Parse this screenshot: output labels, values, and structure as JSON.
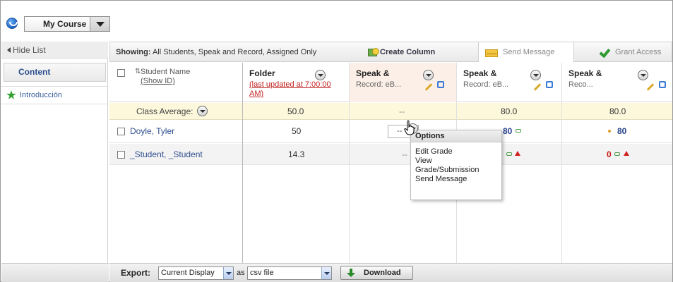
{
  "top": {
    "course_label": "My Course"
  },
  "left": {
    "hide_list": "Hide List",
    "content_tab": "Content",
    "items": [
      "Introducción"
    ]
  },
  "toolbar": {
    "showing_label": "Showing:",
    "showing_value": "All Students, Speak and Record, Assigned Only",
    "create_column": "Create Column",
    "send_message": "Send Message",
    "grant_access": "Grant Access"
  },
  "columns": {
    "student_name": "Student Name",
    "show_id": "(Show ID)",
    "folder_title": "Folder",
    "folder_sub": "(last updated at 7:00:00 AM)",
    "speak1_title": "Speak &",
    "speak1_sub": "Record: eB...",
    "speak2_title": "Speak &",
    "speak2_sub": "Record: eB...",
    "speak3_title": "Speak &",
    "speak3_sub": "Reco..."
  },
  "average": {
    "label": "Class Average:",
    "folder": "50.0",
    "speak1": "--",
    "speak2": "80.0",
    "speak3": "80.0"
  },
  "rows": [
    {
      "name": "Doyle, Tyler",
      "folder": "50",
      "speak1": "--",
      "speak2": "80",
      "speak3": "80"
    },
    {
      "name": "_Student, _Student",
      "folder": "14.3",
      "speak1": "--",
      "speak2": "0",
      "speak3": "0"
    }
  ],
  "popup": {
    "title": "Options",
    "items": [
      "Edit Grade",
      "View",
      "Grade/Submission",
      "Send Message"
    ]
  },
  "footer": {
    "export_label": "Export:",
    "display_value": "Current Display",
    "as_label": "as",
    "format_value": "csv file",
    "download_label": "Download"
  },
  "colors": {
    "link_blue": "#2f4e8f",
    "average_bg": "#fdf8db",
    "speak_header_bg": "#fcefe7",
    "error_red": "#cc1b1b"
  }
}
